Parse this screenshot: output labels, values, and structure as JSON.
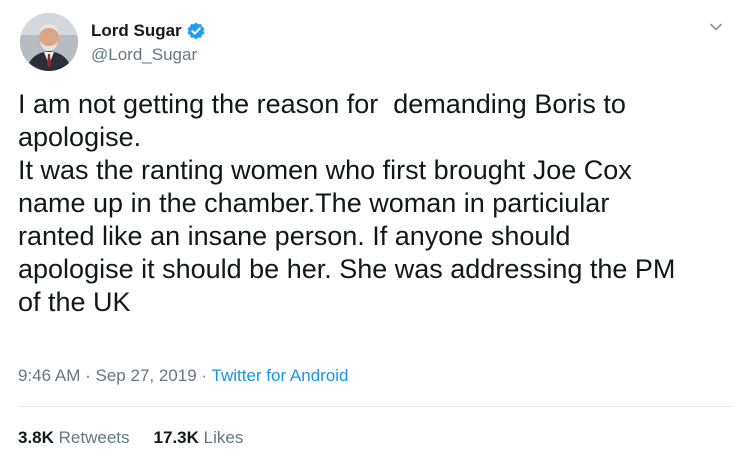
{
  "user": {
    "display_name": "Lord Sugar",
    "handle": "@Lord_Sugar",
    "verified": true
  },
  "tweet": {
    "text": "I am not getting the reason for  demanding Boris to\napologise.\nIt was the ranting women who first brought Joe Cox\nname up in the chamber.The woman in particiular\nranted like an insane person. If anyone should\napologise it should be her. She was addressing the PM\nof the UK",
    "time": "9:46 AM",
    "date": "Sep 27, 2019",
    "separator": "·",
    "source": "Twitter for Android"
  },
  "stats": {
    "retweets_count": "3.8K",
    "retweets_label": "Retweets",
    "likes_count": "17.3K",
    "likes_label": "Likes"
  },
  "icons": {
    "verified": "verified-badge-icon",
    "caret": "chevron-down-icon"
  },
  "colors": {
    "accent": "#1b95e0",
    "verified": "#1da1f2",
    "secondary_text": "#657786",
    "primary_text": "#14171a"
  }
}
